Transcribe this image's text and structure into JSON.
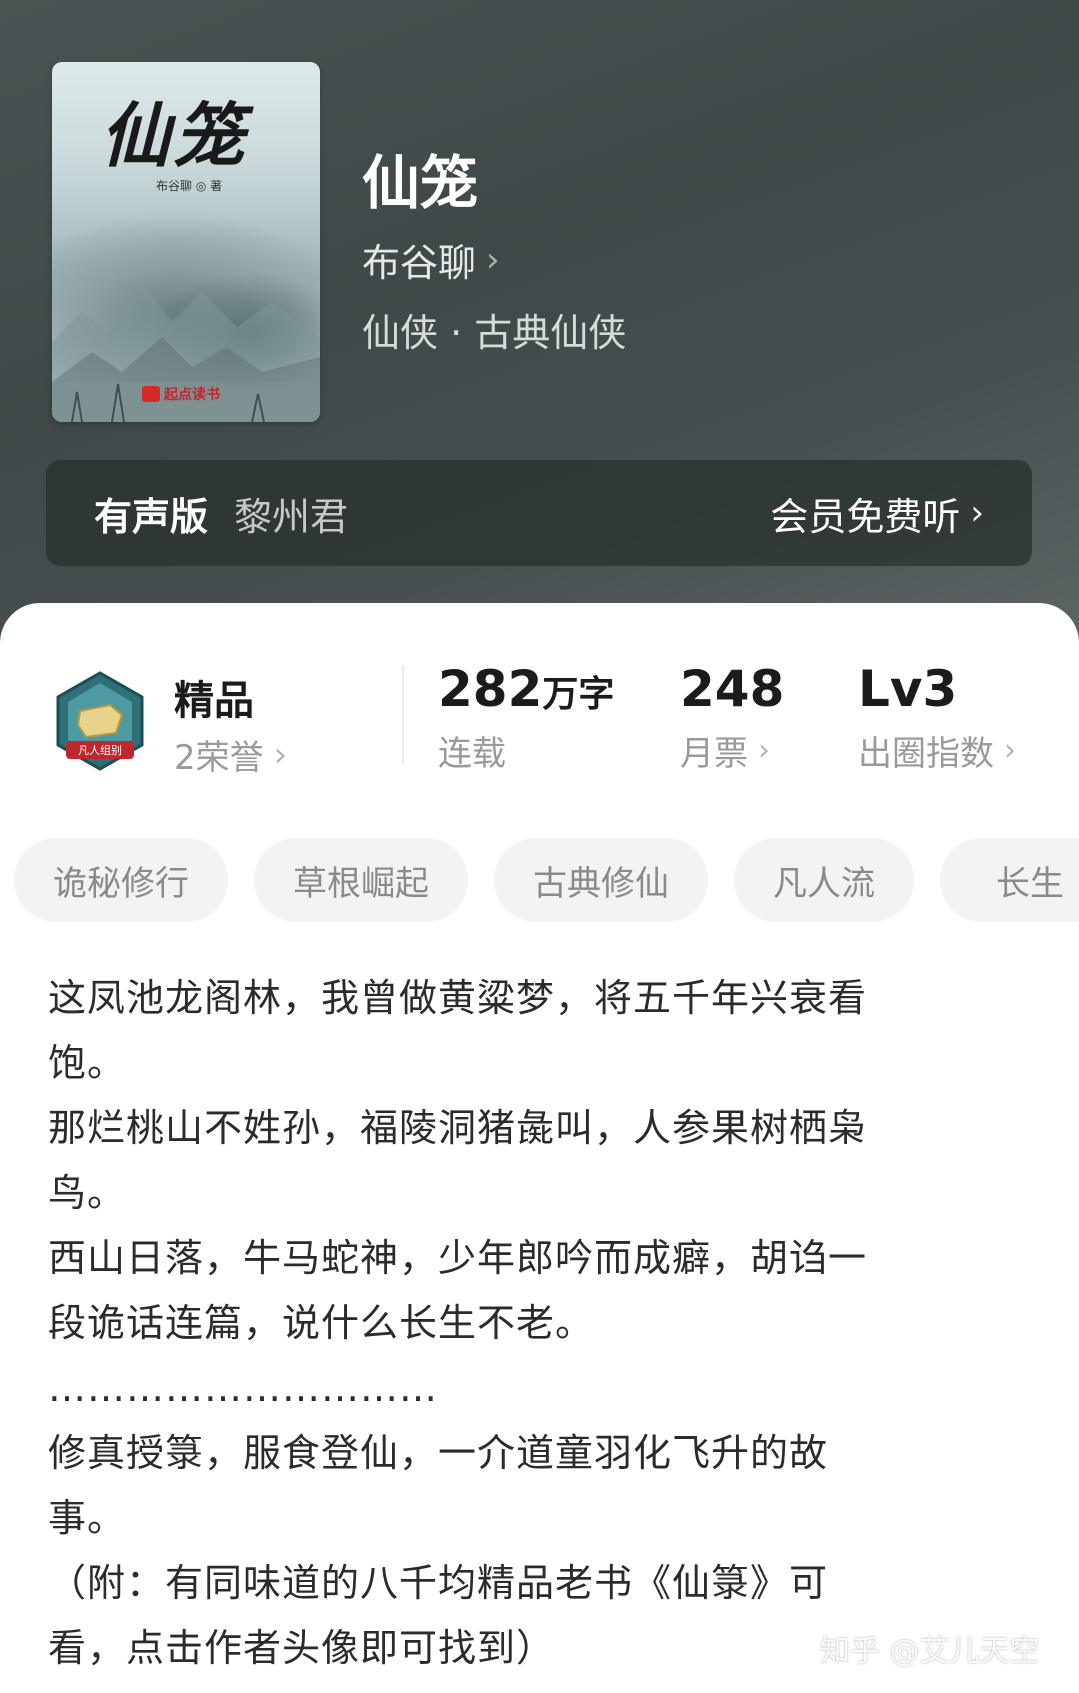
{
  "book": {
    "cover_title": "仙笼",
    "cover_author": "布谷聊 ◎ 著",
    "cover_publisher": "起点读书",
    "title": "仙笼",
    "author": "布谷聊",
    "genre": "仙侠 · 古典仙侠"
  },
  "audio": {
    "label": "有声版",
    "narrator": "黎州君",
    "action": "会员免费听"
  },
  "rank": {
    "badge_text": "凡人组别",
    "title": "精品",
    "honors": "2荣誉"
  },
  "stats": [
    {
      "value": "282",
      "unit": "万字",
      "label": "连载"
    },
    {
      "value": "248",
      "unit": "",
      "label": "月票"
    },
    {
      "value": "Lv3",
      "unit": "",
      "label": "出圈指数"
    }
  ],
  "tags": [
    "诡秘修行",
    "草根崛起",
    "古典修仙",
    "凡人流",
    "长生"
  ],
  "intro": [
    "这凤池龙阁林，我曾做黄粱梦，将五千年兴衰看",
    "饱。",
    "那烂桃山不姓孙，福陵洞猪彘叫，人参果树栖枭",
    "鸟。",
    "西山日落，牛马蛇神，少年郎吟而成癖，胡诌一",
    "段诡话连篇，说什么长生不老。",
    "…………………………",
    "修真授箓，服食登仙，一介道童羽化飞升的故",
    "事。",
    "（附：有同味道的八千均精品老书《仙箓》可",
    "看，点击作者头像即可找到）"
  ],
  "watermark": "知乎 @艾儿天空",
  "icons": {
    "chevron": "chevron-right-icon",
    "badge": "rank-badge-icon"
  }
}
